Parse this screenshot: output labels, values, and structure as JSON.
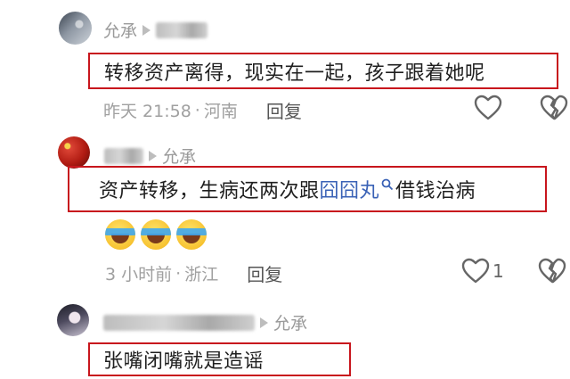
{
  "comments": [
    {
      "author": "",
      "reply_to": "允承",
      "text": "转移资产离得，现实在一起，孩子跟着她呢",
      "time": "昨天 21:58",
      "location": "河南",
      "reply_label": "回复",
      "likes": ""
    },
    {
      "author": "",
      "reply_to": "允承",
      "text_before": "资产转移，生病还两次跟",
      "mention": "囧囧丸",
      "text_after": "借钱治病",
      "emoji_count": 3,
      "emoji_icon": "laugh-cry-emoji",
      "time": "3 小时前",
      "location": "浙江",
      "reply_label": "回复",
      "likes": "1"
    },
    {
      "author": "",
      "reply_to": "允承",
      "text": "张嘴闭嘴就是造谣"
    }
  ],
  "separator": "·",
  "colors": {
    "highlight_border": "#c8161d",
    "mention": "#3a62b6",
    "meta_text": "#a0a0a0"
  },
  "icons": {
    "reply_arrow": "triangle-right-icon",
    "like": "heart-outline-icon",
    "dislike": "broken-heart-icon",
    "search_hint": "search-icon"
  }
}
